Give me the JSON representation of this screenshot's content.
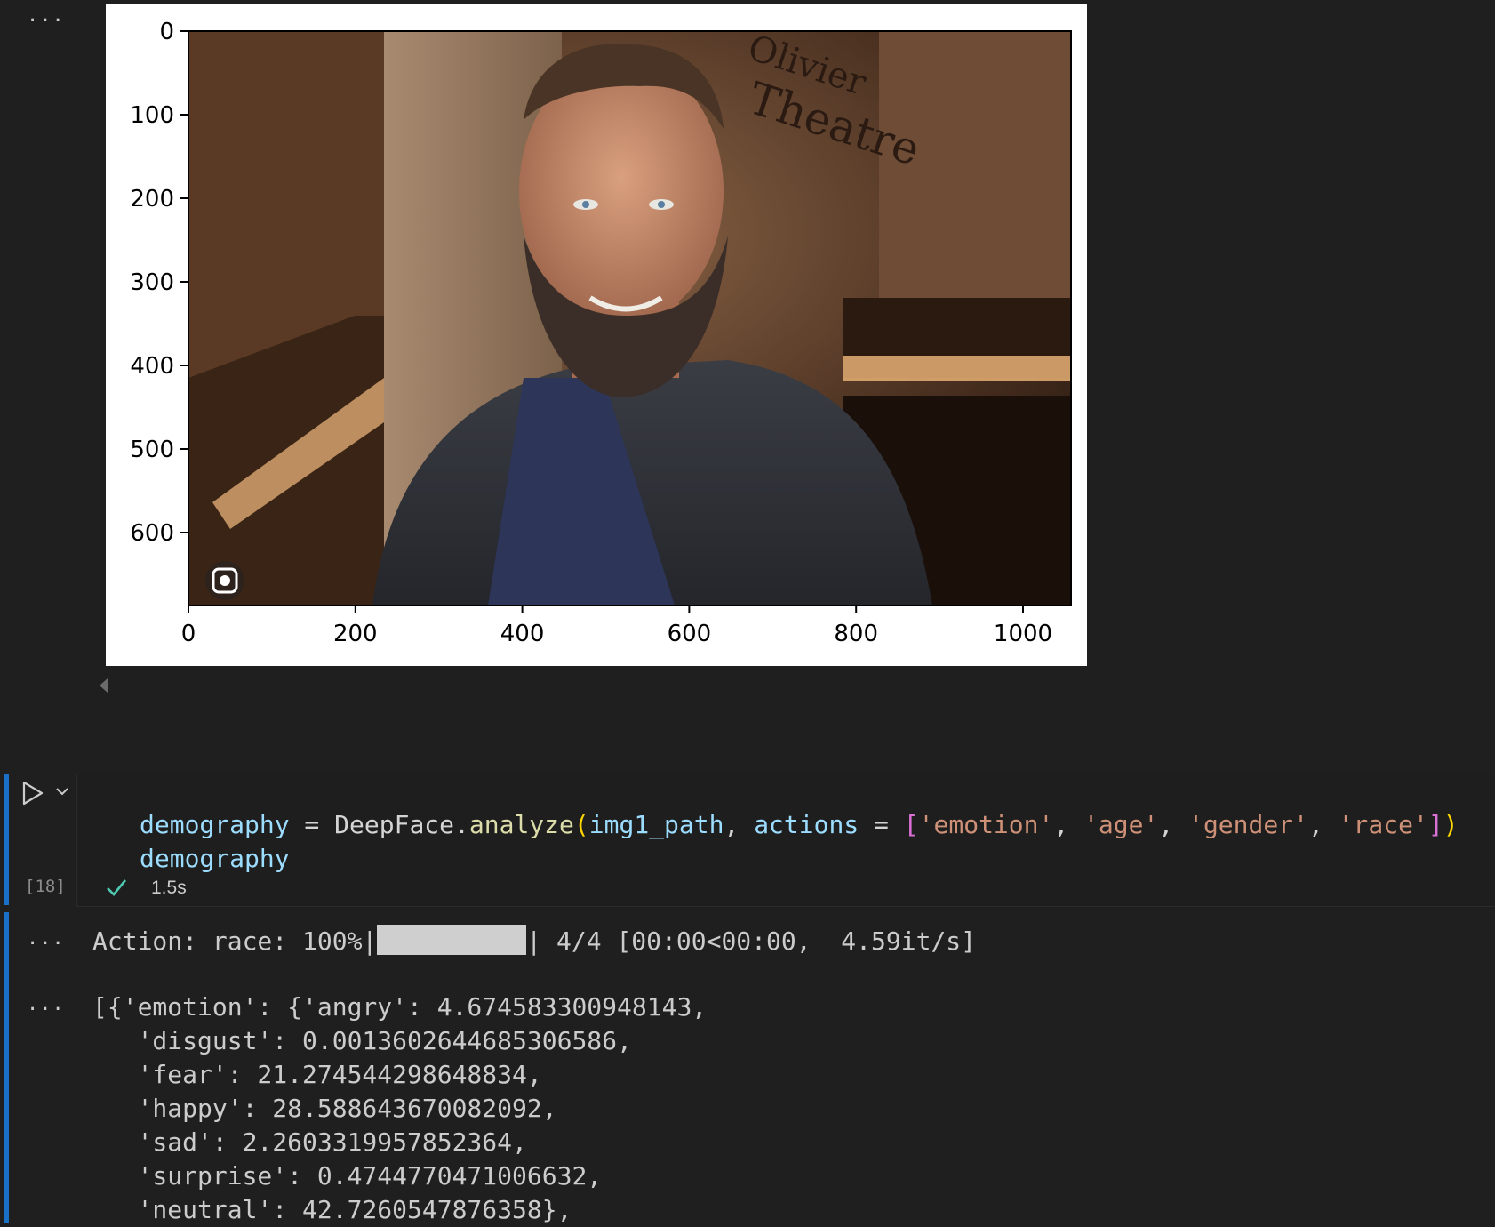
{
  "output_cell_top": {
    "more_actions": "...",
    "figure": {
      "y_ticks": [
        "0",
        "100",
        "200",
        "300",
        "400",
        "500",
        "600"
      ],
      "x_ticks": [
        "0",
        "200",
        "400",
        "600",
        "800",
        "1000"
      ],
      "photo_sign_text": "Olivier Theatre",
      "lens_icon": "google-lens-icon"
    }
  },
  "code_cell": {
    "execution_count": "[18]",
    "status_icon": "checkmark-icon",
    "duration": "1.5s",
    "lines": {
      "l1": {
        "var": "demography",
        "eq": " = ",
        "obj": "DeepFace.",
        "fn": "analyze",
        "open": "(",
        "arg1": "img1_path",
        "comma1": ", ",
        "kw": "actions",
        "eq2": " = ",
        "lbr": "[",
        "s1": "'emotion'",
        "c1": ", ",
        "s2": "'age'",
        "c2": ", ",
        "s3": "'gender'",
        "c3": ", ",
        "s4": "'race'",
        "rbr": "]",
        "close": ")"
      },
      "l2": "demography"
    }
  },
  "outputs": {
    "progress": {
      "more_actions": "...",
      "prefix": "Action: race: 100%|",
      "fraction_complete": 1.0,
      "suffix": "| 4/4 [00:00<00:00,  4.59it/s]"
    },
    "result": {
      "more_actions": "...",
      "lines": [
        "[{'emotion': {'angry': 4.674583300948143,",
        "   'disgust': 0.0013602644685306586,",
        "   'fear': 21.274544298648834,",
        "   'happy': 28.588643670082092,",
        "   'sad': 2.2603319957852364,",
        "   'surprise': 0.4744770471006632,",
        "   'neutral': 42.7260547876358},"
      ]
    }
  }
}
